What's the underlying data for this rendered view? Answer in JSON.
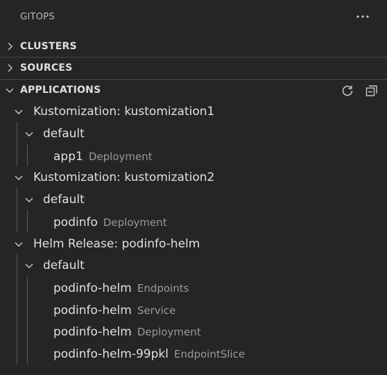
{
  "panel": {
    "title": "GITOPS",
    "more_icon": "ellipsis-icon"
  },
  "sections": {
    "clusters": {
      "label": "CLUSTERS",
      "expanded": false
    },
    "sources": {
      "label": "SOURCES",
      "expanded": false
    },
    "applications": {
      "label": "APPLICATIONS",
      "expanded": true,
      "actions": [
        "refresh-icon",
        "collapse-all-icon"
      ]
    }
  },
  "tree": {
    "k1": {
      "label": "Kustomization: kustomization1"
    },
    "k1_ns": {
      "label": "default"
    },
    "k1_item1": {
      "name": "app1",
      "kind": "Deployment"
    },
    "k2": {
      "label": "Kustomization: kustomization2"
    },
    "k2_ns": {
      "label": "default"
    },
    "k2_item1": {
      "name": "podinfo",
      "kind": "Deployment"
    },
    "h1": {
      "label": "Helm Release: podinfo-helm"
    },
    "h1_ns": {
      "label": "default"
    },
    "h1_item1": {
      "name": "podinfo-helm",
      "kind": "Endpoints"
    },
    "h1_item2": {
      "name": "podinfo-helm",
      "kind": "Service"
    },
    "h1_item3": {
      "name": "podinfo-helm",
      "kind": "Deployment"
    },
    "h1_item4": {
      "name": "podinfo-helm-99pkl",
      "kind": "EndpointSlice"
    }
  },
  "colors": {
    "background": "#252526",
    "text": "#e0e0e0",
    "description": "#9a9a9a",
    "guide": "#585858"
  }
}
